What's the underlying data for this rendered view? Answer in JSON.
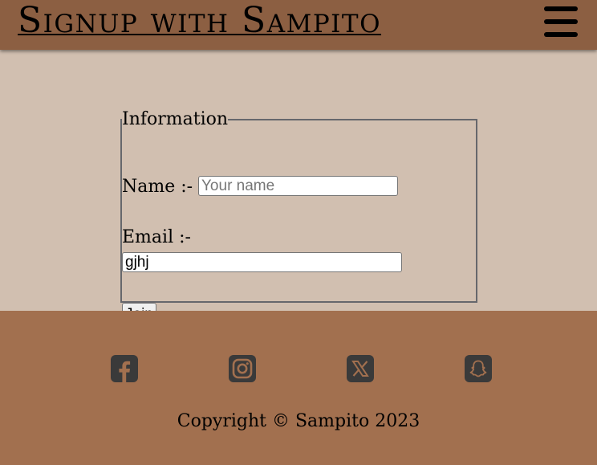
{
  "header": {
    "title": "Signup with Sampito",
    "menu_icon": "hamburger-menu-icon"
  },
  "form": {
    "legend": "Information",
    "name_label": "Name :-",
    "name_placeholder": "Your name",
    "name_value": "",
    "email_label": "Email :-",
    "email_value": "gjhj",
    "join_label": "Join"
  },
  "footer": {
    "social": [
      {
        "icon": "facebook-icon"
      },
      {
        "icon": "instagram-icon"
      },
      {
        "icon": "x-twitter-icon"
      },
      {
        "icon": "snapchat-icon"
      }
    ],
    "copyright": "Copyright © Sampito 2023"
  },
  "colors": {
    "header_bg": "#8c5f42",
    "body_bg": "#d1bfb0",
    "footer_bg": "#a2704f",
    "icon": "#3a3a3a"
  }
}
